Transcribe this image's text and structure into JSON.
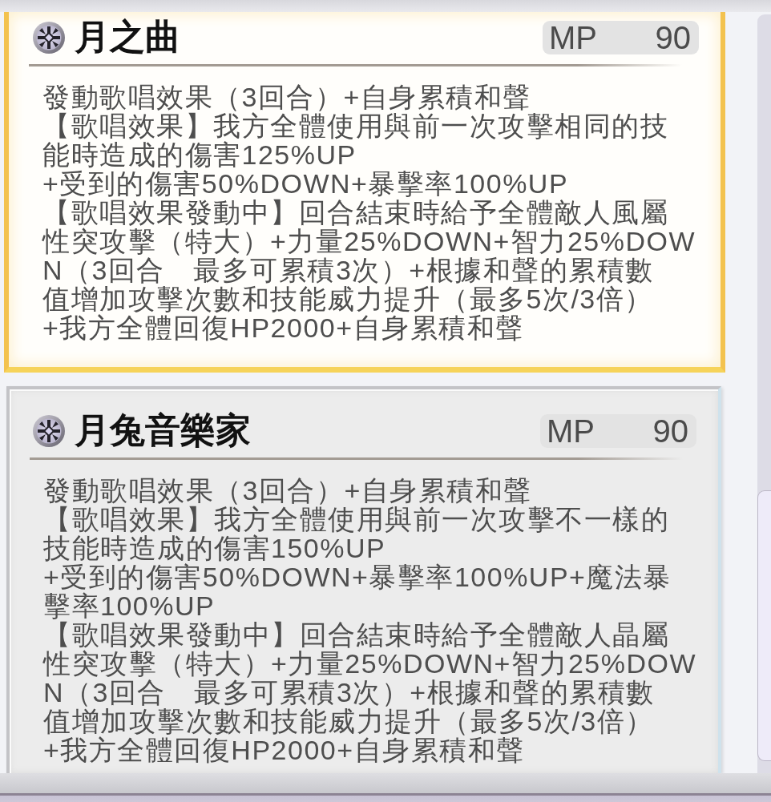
{
  "skills": [
    {
      "name": "月之曲",
      "selected": true,
      "mp_label": "MP",
      "mp_cost": "90",
      "description_lines": [
        "發動歌唱效果（3回合）+自身累積和聲",
        "【歌唱效果】我方全體使用與前一次攻擊相同的技",
        "能時造成的傷害125%UP",
        "+受到的傷害50%DOWN+暴擊率100%UP",
        "【歌唱效果發動中】回合結束時給予全體敵人風屬",
        "性突攻擊（特大）+力量25%DOWN+智力25%DOW",
        "N（3回合　最多可累積3次）+根據和聲的累積數",
        "值增加攻擊次數和技能威力提升（最多5次/3倍）",
        "+我方全體回復HP2000+自身累積和聲"
      ]
    },
    {
      "name": "月兔音樂家",
      "selected": false,
      "mp_label": "MP",
      "mp_cost": "90",
      "description_lines": [
        "發動歌唱效果（3回合）+自身累積和聲",
        "【歌唱效果】我方全體使用與前一次攻擊不一樣的",
        "技能時造成的傷害150%UP",
        "+受到的傷害50%DOWN+暴擊率100%UP+魔法暴",
        "擊率100%UP",
        "【歌唱效果發動中】回合結束時給予全體敵人晶屬",
        "性突攻擊（特大）+力量25%DOWN+智力25%DOW",
        "N（3回合　最多可累積3次）+根據和聲的累積數",
        "值增加攻擊次數和技能威力提升（最多5次/3倍）",
        "+我方全體回復HP2000+自身累積和聲"
      ]
    }
  ]
}
